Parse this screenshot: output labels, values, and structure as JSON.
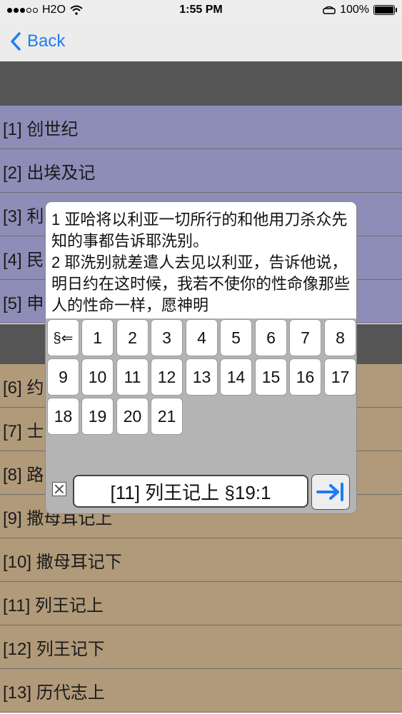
{
  "status": {
    "carrier": "H2O",
    "time": "1:55 PM",
    "battery": "100%"
  },
  "nav": {
    "back_label": "Back"
  },
  "books_group1": [
    "[1] 创世纪",
    "[2] 出埃及记",
    "[3] 利",
    "[4] 民",
    "[5] 申"
  ],
  "books_group2": [
    "[6] 约",
    "[7] 士",
    "[8] 路",
    "[9] 撒母耳记上",
    "[10] 撒母耳记下",
    "[11] 列王记上",
    "[12] 列王记下",
    "[13] 历代志上"
  ],
  "popup": {
    "verses": [
      "1 亚哈将以利亚一切所行的和他用刀杀众先知的事都告诉耶洗别。",
      "2 耶洗别就差遣人去见以利亚，告诉他说，明日约在这时候，我若不使你的性命像那些人的性命一样，愿神明"
    ],
    "section_key": "§⇐",
    "numbers": [
      "1",
      "2",
      "3",
      "4",
      "5",
      "6",
      "7",
      "8",
      "9",
      "10",
      "11",
      "12",
      "13",
      "14",
      "15",
      "16",
      "17",
      "18",
      "19",
      "20",
      "21"
    ],
    "reference": "[11] 列王记上 §19:1"
  },
  "colors": {
    "accent": "#1e7cf2",
    "list_purple": "#8e8db7",
    "list_tan": "#b19a7a",
    "section_dark": "#555555"
  }
}
